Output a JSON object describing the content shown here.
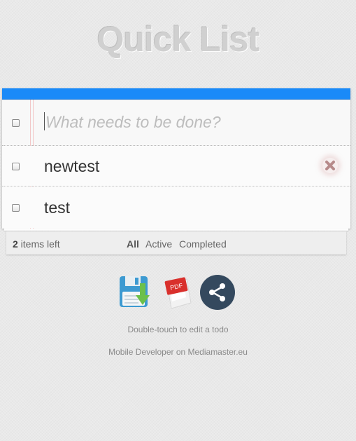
{
  "app": {
    "title": "Quick List"
  },
  "new_todo": {
    "placeholder": "What needs to be done?",
    "value": ""
  },
  "todos": [
    {
      "label": "newtest",
      "completed": false,
      "delete_icon": "close-x-icon"
    },
    {
      "label": "test",
      "completed": false,
      "delete_icon": "close-x-icon"
    }
  ],
  "footer": {
    "count": "2",
    "count_suffix": " items left",
    "filters": [
      "All",
      "Active",
      "Completed"
    ],
    "selected_filter": "All"
  },
  "actions": {
    "icons": [
      "save-download-icon",
      "pdf-icon",
      "share-icon"
    ]
  },
  "info": {
    "hint": "Double-touch to edit a todo",
    "credit": "Mobile Developer on Mediamaster.eu"
  },
  "colors": {
    "accent_bar": "#1a8af8",
    "background": "#e9e9e9",
    "share_circle": "#34495e",
    "pdf_red": "#d9302c",
    "save_blue": "#3d9ad1",
    "save_green": "#6cc04a"
  }
}
